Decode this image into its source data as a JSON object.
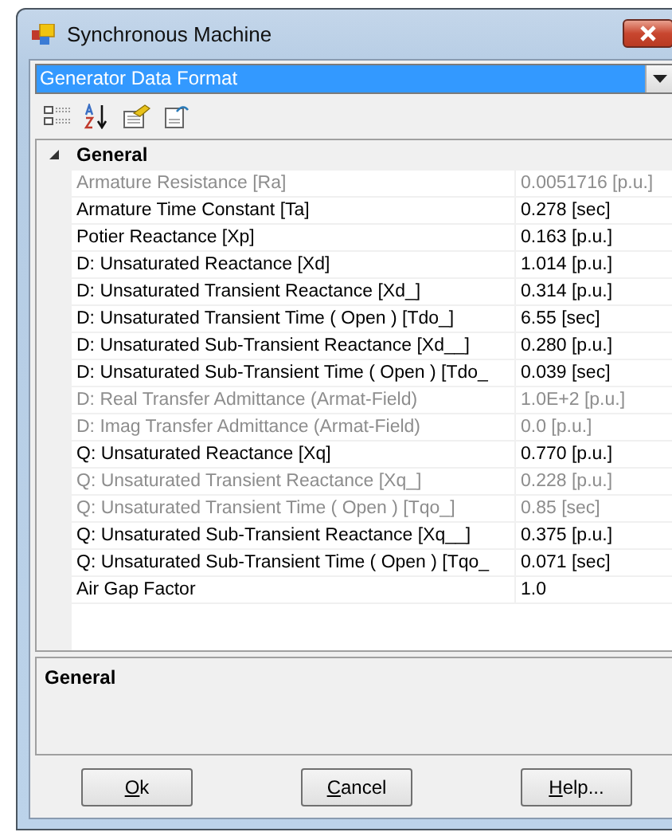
{
  "window": {
    "title": "Synchronous Machine"
  },
  "selector": {
    "value": "Generator Data Format"
  },
  "toolbar": {
    "buttons": [
      {
        "kind": "categorized"
      },
      {
        "kind": "alphabetical"
      },
      {
        "kind": "properties"
      },
      {
        "kind": "pages"
      }
    ]
  },
  "grid": {
    "category": {
      "label": "General",
      "expanded": true
    },
    "rows": [
      {
        "name": "Armature Resistance [Ra]",
        "value": "0.0051716 [p.u.]",
        "disabled": true
      },
      {
        "name": "Armature Time Constant [Ta]",
        "value": "0.278 [sec]",
        "disabled": false
      },
      {
        "name": "Potier Reactance [Xp]",
        "value": "0.163 [p.u.]",
        "disabled": false
      },
      {
        "name": "D: Unsaturated Reactance [Xd]",
        "value": "1.014 [p.u.]",
        "disabled": false
      },
      {
        "name": "D: Unsaturated Transient Reactance [Xd_]",
        "value": "0.314 [p.u.]",
        "disabled": false
      },
      {
        "name": "D: Unsaturated Transient Time  ( Open ) [Tdo_]",
        "value": "6.55 [sec]",
        "disabled": false
      },
      {
        "name": "D: Unsaturated Sub-Transient Reactance [Xd__]",
        "value": "0.280 [p.u.]",
        "disabled": false
      },
      {
        "name": "D: Unsaturated Sub-Transient Time ( Open ) [Tdo_",
        "value": "0.039 [sec]",
        "disabled": false
      },
      {
        "name": "D: Real Transfer Admittance (Armat-Field)",
        "value": "1.0E+2 [p.u.]",
        "disabled": true
      },
      {
        "name": "D: Imag Transfer Admittance (Armat-Field)",
        "value": "0.0 [p.u.]",
        "disabled": true
      },
      {
        "name": "Q: Unsaturated Reactance [Xq]",
        "value": "0.770 [p.u.]",
        "disabled": false
      },
      {
        "name": "Q: Unsaturated Transient Reactance [Xq_]",
        "value": "0.228 [p.u.]",
        "disabled": true
      },
      {
        "name": "Q: Unsaturated Transient Time  ( Open ) [Tqo_]",
        "value": "0.85 [sec]",
        "disabled": true
      },
      {
        "name": "Q: Unsaturated Sub-Transient Reactance [Xq__]",
        "value": "0.375 [p.u.]",
        "disabled": false
      },
      {
        "name": "Q: Unsaturated Sub-Transient Time ( Open ) [Tqo_",
        "value": "0.071 [sec]",
        "disabled": false
      },
      {
        "name": "Air Gap Factor",
        "value": "1.0",
        "disabled": false
      }
    ]
  },
  "description": {
    "title": "General"
  },
  "buttons": [
    {
      "label": "Ok"
    },
    {
      "label": "Cancel"
    },
    {
      "label": "Help..."
    }
  ]
}
